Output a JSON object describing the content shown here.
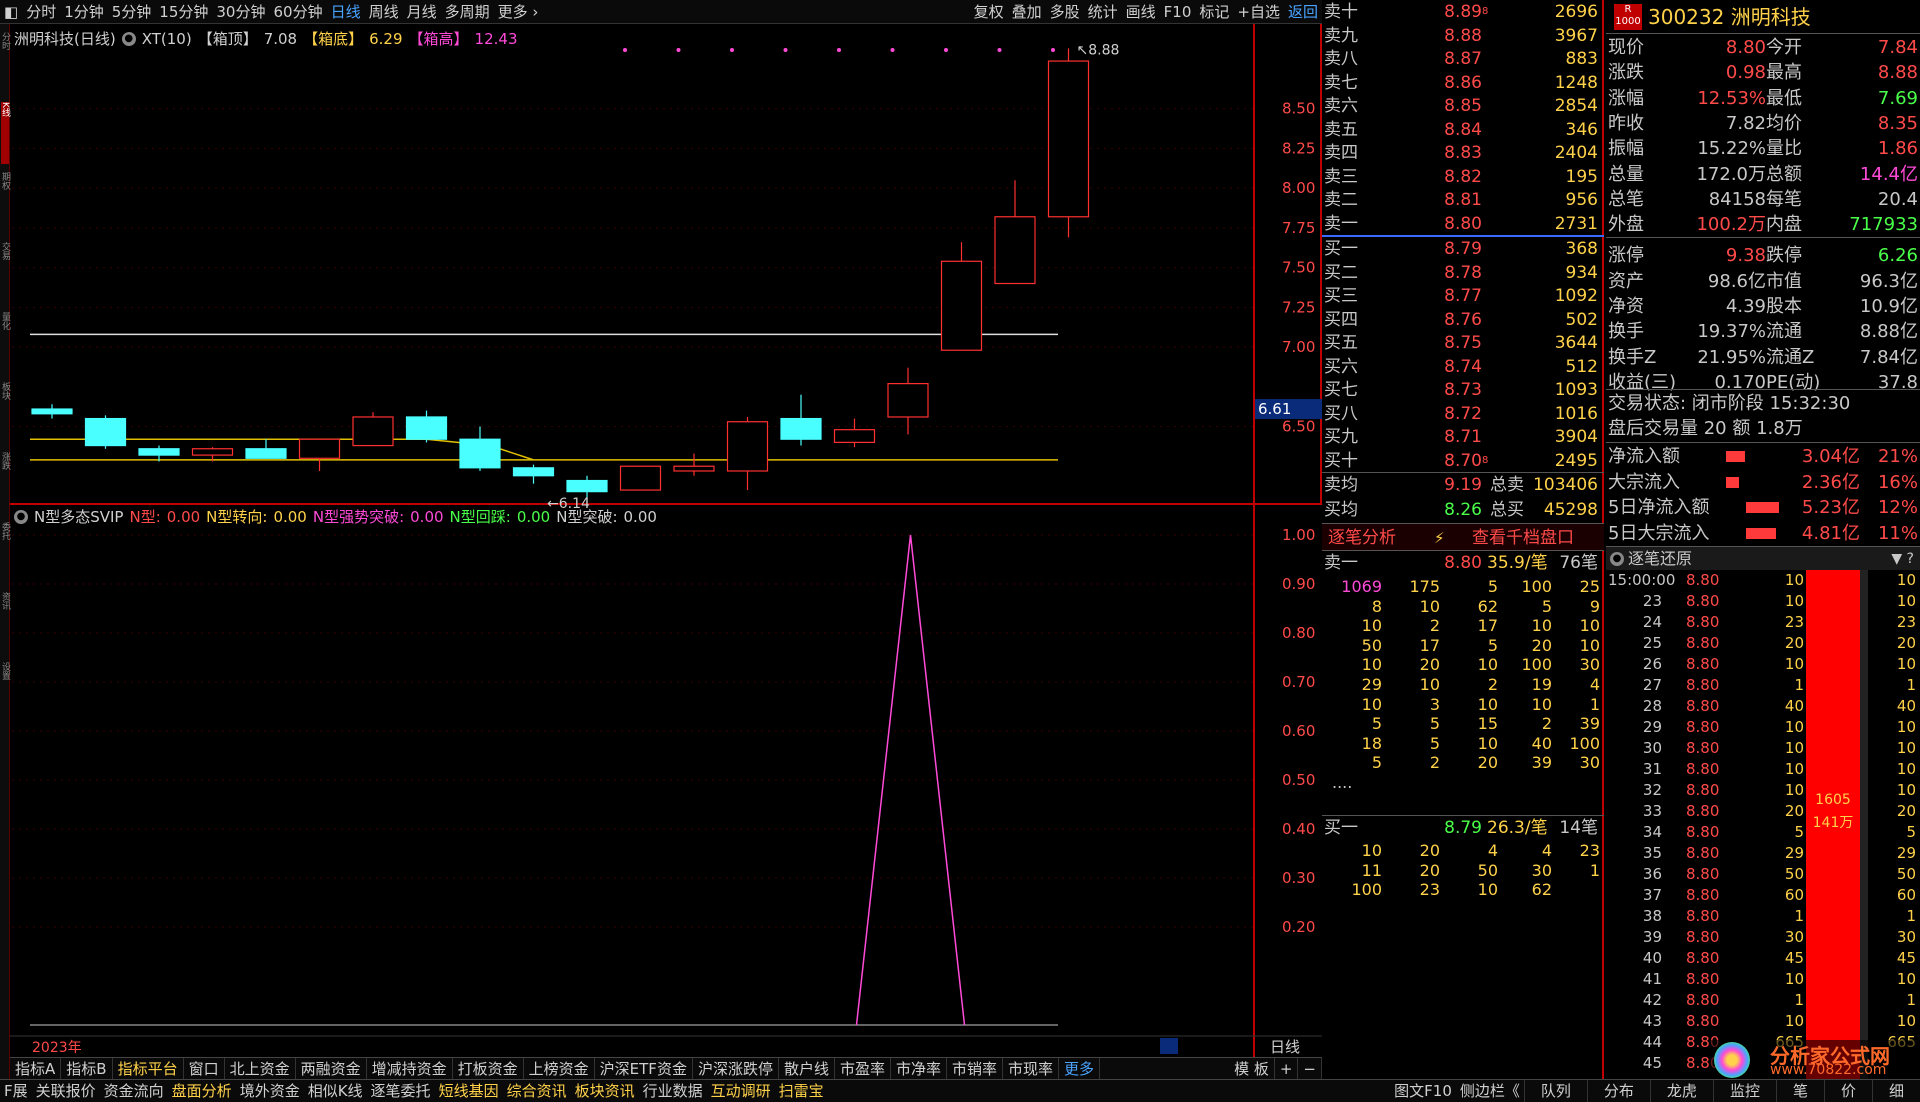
{
  "toolbar": {
    "left": [
      "分时",
      "1分钟",
      "5分钟",
      "15分钟",
      "30分钟",
      "60分钟",
      "日线",
      "周线",
      "月线",
      "多周期",
      "更多 ›"
    ],
    "active": "日线",
    "right": [
      "复权",
      "叠加",
      "多股",
      "统计",
      "画线",
      "F10",
      "标记",
      "+自选",
      "返回"
    ]
  },
  "left_strip": [
    "分时",
    "K线",
    "期权",
    "交易",
    "量化",
    "板块",
    "涨跌",
    "委托",
    "资讯",
    "设置"
  ],
  "chart_header": {
    "name": "洲明科技(日线)",
    "indicator": "XT(10)",
    "box_top_label": "【箱顶】",
    "box_top": "7.08",
    "box_bottom_label": "【箱底】",
    "box_bottom": "6.29",
    "box_high_label": "【箱高】",
    "box_high": "12.43"
  },
  "main_axis": {
    "ticks": [
      "8.50",
      "8.25",
      "8.00",
      "7.75",
      "7.50",
      "7.25",
      "7.00",
      "6.50"
    ],
    "last_price": "6.61",
    "high_label": "8.88",
    "low_label": "6.14"
  },
  "sub_header": {
    "name": "N型多态SVIP",
    "a_label": "N型:",
    "a_val": "0.00",
    "b_label": "N型转向:",
    "b_val": "0.00",
    "c_label": "N型强势突破:",
    "c_val": "0.00",
    "d_label": "N型回踩:",
    "d_val": "0.00",
    "e_label": "N型突破:",
    "e_val": "0.00"
  },
  "sub_axis": {
    "ticks": [
      "1.00",
      "0.90",
      "0.80",
      "0.70",
      "0.60",
      "0.50",
      "0.40",
      "0.30",
      "0.20"
    ]
  },
  "chart_data": {
    "type": "candlestick",
    "candles": [
      {
        "o": 6.61,
        "c": 6.58,
        "h": 6.64,
        "l": 6.55,
        "col": "cyan"
      },
      {
        "o": 6.55,
        "c": 6.38,
        "h": 6.57,
        "l": 6.36,
        "col": "cyan"
      },
      {
        "o": 6.36,
        "c": 6.32,
        "h": 6.38,
        "l": 6.28,
        "col": "cyan"
      },
      {
        "o": 6.32,
        "c": 6.36,
        "h": 6.37,
        "l": 6.28,
        "col": "red"
      },
      {
        "o": 6.36,
        "c": 6.3,
        "h": 6.42,
        "l": 6.3,
        "col": "cyan"
      },
      {
        "o": 6.3,
        "c": 6.42,
        "h": 6.42,
        "l": 6.22,
        "col": "red"
      },
      {
        "o": 6.38,
        "c": 6.56,
        "h": 6.59,
        "l": 6.38,
        "col": "red"
      },
      {
        "o": 6.56,
        "c": 6.42,
        "h": 6.6,
        "l": 6.4,
        "col": "cyan"
      },
      {
        "o": 6.42,
        "c": 6.24,
        "h": 6.5,
        "l": 6.22,
        "col": "cyan"
      },
      {
        "o": 6.24,
        "c": 6.19,
        "h": 6.26,
        "l": 6.14,
        "col": "cyan"
      },
      {
        "o": 6.16,
        "c": 6.09,
        "h": 6.19,
        "l": 6.05,
        "col": "cyan"
      },
      {
        "o": 6.1,
        "c": 6.25,
        "h": 6.25,
        "l": 6.1,
        "col": "red"
      },
      {
        "o": 6.22,
        "c": 6.25,
        "h": 6.33,
        "l": 6.19,
        "col": "red"
      },
      {
        "o": 6.22,
        "c": 6.53,
        "h": 6.56,
        "l": 6.1,
        "col": "red"
      },
      {
        "o": 6.55,
        "c": 6.42,
        "h": 6.7,
        "l": 6.38,
        "col": "cyan"
      },
      {
        "o": 6.4,
        "c": 6.48,
        "h": 6.55,
        "l": 6.37,
        "col": "red"
      },
      {
        "o": 6.56,
        "c": 6.77,
        "h": 6.87,
        "l": 6.45,
        "col": "red"
      },
      {
        "o": 6.98,
        "c": 7.54,
        "h": 7.66,
        "l": 6.98,
        "col": "red"
      },
      {
        "o": 7.4,
        "c": 7.82,
        "h": 8.05,
        "l": 7.4,
        "col": "red"
      },
      {
        "o": 7.82,
        "c": 8.8,
        "h": 8.88,
        "l": 7.69,
        "col": "red"
      }
    ],
    "box_top": 7.08,
    "box_bottom": 6.29,
    "signal": {
      "x_index": 19,
      "value": 1.0
    }
  },
  "order_book": {
    "asks": [
      {
        "label": "卖十",
        "price": "8.89",
        "vol": "2696",
        "mk": "8"
      },
      {
        "label": "卖九",
        "price": "8.88",
        "vol": "3967"
      },
      {
        "label": "卖八",
        "price": "8.87",
        "vol": "883"
      },
      {
        "label": "卖七",
        "price": "8.86",
        "vol": "1248"
      },
      {
        "label": "卖六",
        "price": "8.85",
        "vol": "2854"
      },
      {
        "label": "卖五",
        "price": "8.84",
        "vol": "346"
      },
      {
        "label": "卖四",
        "price": "8.83",
        "vol": "2404"
      },
      {
        "label": "卖三",
        "price": "8.82",
        "vol": "195"
      },
      {
        "label": "卖二",
        "price": "8.81",
        "vol": "956"
      },
      {
        "label": "卖一",
        "price": "8.80",
        "vol": "2731"
      }
    ],
    "bids": [
      {
        "label": "买一",
        "price": "8.79",
        "vol": "368"
      },
      {
        "label": "买二",
        "price": "8.78",
        "vol": "934"
      },
      {
        "label": "买三",
        "price": "8.77",
        "vol": "1092"
      },
      {
        "label": "买四",
        "price": "8.76",
        "vol": "502"
      },
      {
        "label": "买五",
        "price": "8.75",
        "vol": "3644"
      },
      {
        "label": "买六",
        "price": "8.74",
        "vol": "512"
      },
      {
        "label": "买七",
        "price": "8.73",
        "vol": "1093"
      },
      {
        "label": "买八",
        "price": "8.72",
        "vol": "1016"
      },
      {
        "label": "买九",
        "price": "8.71",
        "vol": "3904"
      },
      {
        "label": "买十",
        "price": "8.70",
        "vol": "2495",
        "mk": "8"
      }
    ],
    "ask_avg_label": "卖均",
    "ask_avg": "9.19",
    "ask_total_label": "总卖",
    "ask_total": "103406",
    "bid_avg_label": "买均",
    "bid_avg": "8.26",
    "bid_total_label": "总买",
    "bid_total": "45298"
  },
  "tick_tab": {
    "a": "逐笔分析",
    "b": "⚡",
    "c": "查看千档盘口"
  },
  "sell_queue": {
    "label": "卖一",
    "price": "8.80",
    "mid": "35.9/笔",
    "count": "76笔",
    "rows": [
      [
        "1069",
        "175",
        "5",
        "100",
        "25"
      ],
      [
        "8",
        "10",
        "62",
        "5",
        "9"
      ],
      [
        "10",
        "2",
        "17",
        "10",
        "10"
      ],
      [
        "50",
        "17",
        "5",
        "20",
        "10"
      ],
      [
        "10",
        "20",
        "10",
        "100",
        "30"
      ],
      [
        "29",
        "10",
        "2",
        "19",
        "4"
      ],
      [
        "10",
        "3",
        "10",
        "10",
        "1"
      ],
      [
        "5",
        "5",
        "15",
        "2",
        "39"
      ],
      [
        "18",
        "5",
        "10",
        "40",
        "100"
      ],
      [
        "5",
        "2",
        "20",
        "39",
        "30"
      ]
    ],
    "more": "...."
  },
  "buy_queue": {
    "label": "买一",
    "price": "8.79",
    "mid": "26.3/笔",
    "count": "14笔",
    "rows": [
      [
        "10",
        "20",
        "4",
        "4",
        "23"
      ],
      [
        "11",
        "20",
        "50",
        "30",
        "1"
      ],
      [
        "100",
        "23",
        "10",
        "62",
        ""
      ]
    ]
  },
  "quote": {
    "badge": "R 1000",
    "code_name": "300232 洲明科技",
    "fields": [
      [
        "现价",
        "8.80",
        "r",
        "今开",
        "7.84",
        "r"
      ],
      [
        "涨跌",
        "0.98",
        "r",
        "最高",
        "8.88",
        "r"
      ],
      [
        "涨幅",
        "12.53%",
        "r",
        "最低",
        "7.69",
        "g"
      ],
      [
        "昨收",
        "7.82",
        "w",
        "均价",
        "8.35",
        "r"
      ],
      [
        "振幅",
        "15.22%",
        "w",
        "量比",
        "1.86",
        "r"
      ],
      [
        "总量",
        "172.0万",
        "w",
        "总额",
        "14.4亿",
        "m"
      ],
      [
        "总笔",
        "84158",
        "w",
        "每笔",
        "20.4",
        "w"
      ],
      [
        "外盘",
        "100.2万",
        "r",
        "内盘",
        "717933",
        "g"
      ],
      [
        "涨停",
        "9.38",
        "r",
        "跌停",
        "6.26",
        "g"
      ],
      [
        "资产",
        "98.6亿",
        "w",
        "市值",
        "96.3亿",
        "w"
      ],
      [
        "净资",
        "4.39",
        "w",
        "股本",
        "10.9亿",
        "w"
      ],
      [
        "换手",
        "19.37%",
        "w",
        "流通",
        "8.88亿",
        "w"
      ],
      [
        "换手Z",
        "21.95%",
        "w",
        "流通Z",
        "7.84亿",
        "w"
      ],
      [
        "收益(三)",
        "0.170",
        "w",
        "PE(动)",
        "37.8",
        "w"
      ]
    ],
    "state1": "交易状态: 闭市阶段 15:32:30",
    "state2": "盘后交易量 20 额 1.8万",
    "flows": [
      {
        "label": "净流入额",
        "bar": 0.32,
        "val": "3.04亿",
        "pct": "21%"
      },
      {
        "label": "大宗流入",
        "bar": 0.22,
        "val": "2.36亿",
        "pct": "16%"
      },
      {
        "label": "5日净流入额",
        "bar": 0.55,
        "val": "5.23亿",
        "pct": "12%"
      },
      {
        "label": "5日大宗流入",
        "bar": 0.5,
        "val": "4.81亿",
        "pct": "11%"
      }
    ]
  },
  "tick_head": {
    "title": "逐笔还原",
    "right": "▼ ?"
  },
  "ticks": [
    [
      "15:00:00",
      "8.80",
      "10",
      "10"
    ],
    [
      "23",
      "8.80",
      "10",
      "10"
    ],
    [
      "24",
      "8.80",
      "23",
      "23"
    ],
    [
      "25",
      "8.80",
      "20",
      "20"
    ],
    [
      "26",
      "8.80",
      "10",
      "10"
    ],
    [
      "27",
      "8.80",
      "1",
      "1"
    ],
    [
      "28",
      "8.80",
      "40",
      "40"
    ],
    [
      "29",
      "8.80",
      "10",
      "10"
    ],
    [
      "30",
      "8.80",
      "10",
      "10"
    ],
    [
      "31",
      "8.80",
      "10",
      "10"
    ],
    [
      "32",
      "8.80",
      "10",
      "10"
    ],
    [
      "33",
      "8.80",
      "20",
      "20"
    ],
    [
      "34",
      "8.80",
      "5",
      "5"
    ],
    [
      "35",
      "8.80",
      "29",
      "29"
    ],
    [
      "36",
      "8.80",
      "50",
      "50"
    ],
    [
      "37",
      "8.80",
      "60",
      "60"
    ],
    [
      "38",
      "8.80",
      "1",
      "1"
    ],
    [
      "39",
      "8.80",
      "30",
      "30"
    ],
    [
      "40",
      "8.80",
      "45",
      "45"
    ],
    [
      "41",
      "8.80",
      "10",
      "10"
    ],
    [
      "42",
      "8.80",
      "1",
      "1"
    ],
    [
      "43",
      "8.80",
      "10",
      "10"
    ],
    [
      "44",
      "8.80",
      "665",
      "665"
    ],
    [
      "45",
      "8.80",
      "",
      ""
    ]
  ],
  "tick_bar": {
    "t1": "1605",
    "t2": "141万"
  },
  "bottom_tabs": [
    "指标A",
    "指标B",
    "指标平台",
    "窗口",
    "北上资金",
    "两融资金",
    "增减持资金",
    "打板资金",
    "上榜资金",
    "沪深ETF资金",
    "沪深涨跌停",
    "散户线",
    "市盈率",
    "市净率",
    "市销率",
    "市现率",
    "更多",
    "模 板",
    "+",
    "−"
  ],
  "bottom_active": "指标平台",
  "year_label": "2023年",
  "period_label": "日线",
  "status_bar": [
    "F展",
    "关联报价",
    "资金流向",
    "盘面分析",
    "境外资金",
    "相似K线",
    "逐笔委托",
    "短线基因",
    "综合资讯",
    "板块资讯",
    "行业数据",
    "互动调研",
    "扫雷宝"
  ],
  "status_active": [
    "盘面分析",
    "短线基因",
    "综合资讯",
    "板块资讯",
    "互动调研",
    "扫雷宝"
  ],
  "status_right": [
    "图文F10",
    "侧边栏《"
  ],
  "status_tabs2": [
    "队列",
    "分布",
    "龙虎",
    "监控",
    "笔",
    "价",
    "细"
  ],
  "watermark": {
    "w1": "分析家公式网",
    "w2": "www.70822.com"
  }
}
